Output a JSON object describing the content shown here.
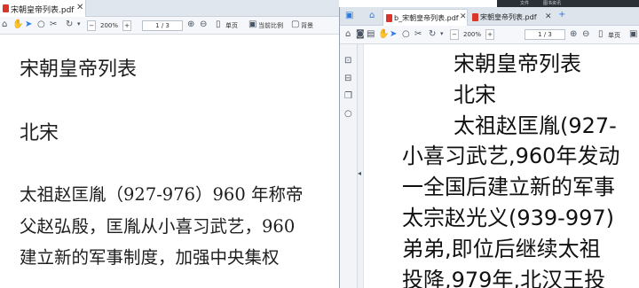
{
  "left_window": {
    "tab_title": "宋朝皇帝列表.pdf",
    "toolbar": {
      "zoom": "200%",
      "page": "1 / 3",
      "single_page": "单页",
      "actual_ratio": "当前比例",
      "background": "背景"
    },
    "document": {
      "title": "宋朝皇帝列表",
      "section": "北宋",
      "line1": "太祖赵匡胤（927-976）960 年称帝",
      "line2": "父赵弘殷，匡胤从小喜习武艺，960",
      "line3": "建立新的军事制度，加强中央集权"
    }
  },
  "right_window": {
    "tabs": [
      {
        "label": "b_宋朝皇帝列表.pdf"
      },
      {
        "label": "宋朝皇帝列表.pdf"
      }
    ],
    "toolbar": {
      "zoom": "200%",
      "page": "1 / 3",
      "single_page": "单页"
    },
    "document": {
      "title": "宋朝皇帝列表",
      "section": "北宋",
      "line1": "太祖赵匡胤(927-",
      "line2": "小喜习武艺,960年发动",
      "line3": "一全国后建立新的军事",
      "line4": "太宗赵光义(939-997)",
      "line5": "弟弟,即位后继续太祖",
      "line6": "投降,979年,北汉王投"
    }
  },
  "background_strip": {
    "item1": "文件",
    "item2": "图书资讯"
  },
  "colors": {
    "tab_bar": "#dfe6ee",
    "toolbar": "#f5f7fa",
    "pdf_red": "#d9362b",
    "accent_blue": "#2d7be5"
  }
}
